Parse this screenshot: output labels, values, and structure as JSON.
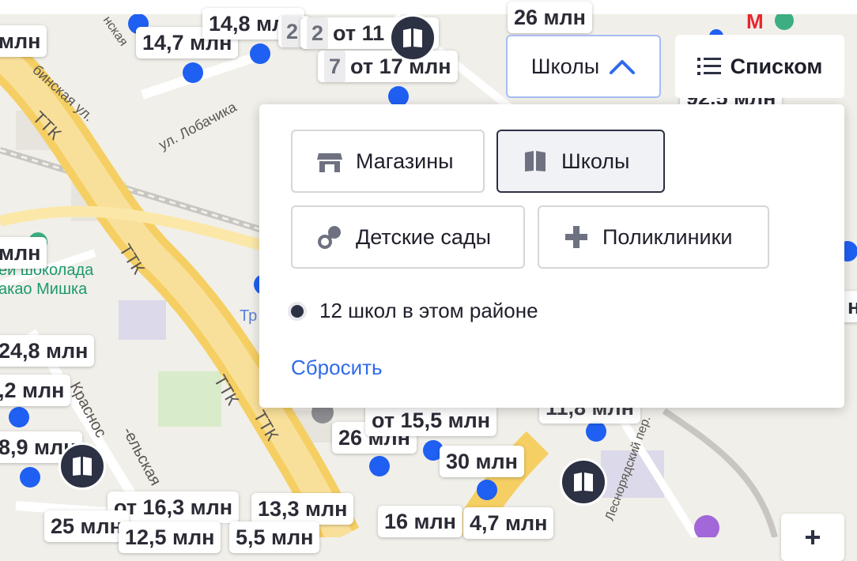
{
  "map": {
    "street_labels": [
      "ТТК",
      "ТТК",
      "ТТК",
      "ТТК",
      "ул. Лобачика",
      "бинская ул.",
      "Краснос",
      "-ельская",
      "Леснорядский пер.",
      "нская"
    ],
    "place_label": {
      "line1": "ей шоколада",
      "line2": "акао Мишка"
    },
    "cropped_label": "Тр",
    "price_tags": [
      {
        "count": "",
        "text": "млн"
      },
      {
        "count": "",
        "text": "14,7 млн"
      },
      {
        "count": "",
        "text": "14,8 млн"
      },
      {
        "count": "2",
        "text": ""
      },
      {
        "count": "2",
        "text": "от 11 млн"
      },
      {
        "count": "7",
        "text": "от 17 млн"
      },
      {
        "count": "",
        "text": "млн"
      },
      {
        "count": "",
        "text": "24,8 млн"
      },
      {
        "count": "",
        "text": ",2 млн"
      },
      {
        "count": "",
        "text": "8,9 млн"
      },
      {
        "count": "",
        "text": "26 млн"
      },
      {
        "count": "",
        "text": "от 15,5 млн"
      },
      {
        "count": "",
        "text": "30 млн"
      },
      {
        "count": "",
        "text": "11,8 млн"
      },
      {
        "count": "",
        "text": "от 16,3 млн"
      },
      {
        "count": "",
        "text": "13,3 млн"
      },
      {
        "count": "",
        "text": "16 млн"
      },
      {
        "count": "",
        "text": "4,7 млн"
      },
      {
        "count": "",
        "text": "25 млн"
      },
      {
        "count": "",
        "text": "12,5 млн"
      },
      {
        "count": "",
        "text": "5,5 млн"
      },
      {
        "count": "",
        "text": "26 млн"
      },
      {
        "count": "",
        "text": "92,5 млн"
      },
      {
        "count": "",
        "text": "н"
      }
    ],
    "metro_label": "М"
  },
  "controls": {
    "schools_label": "Школы",
    "list_label": "Списком"
  },
  "panel": {
    "chips": [
      {
        "label": "Магазины",
        "icon": "shop-icon",
        "active": false
      },
      {
        "label": "Школы",
        "icon": "book-icon",
        "active": true
      },
      {
        "label": "Детские сады",
        "icon": "pacifier-icon",
        "active": false
      },
      {
        "label": "Поликлиники",
        "icon": "plus-icon",
        "active": false
      }
    ],
    "info_text": "12 школ в этом районе",
    "reset_label": "Сбросить"
  },
  "colors": {
    "accent": "#2f6bea",
    "marker": "#1f5ff2",
    "dark": "#2c3143",
    "road": "#f7d97c"
  }
}
